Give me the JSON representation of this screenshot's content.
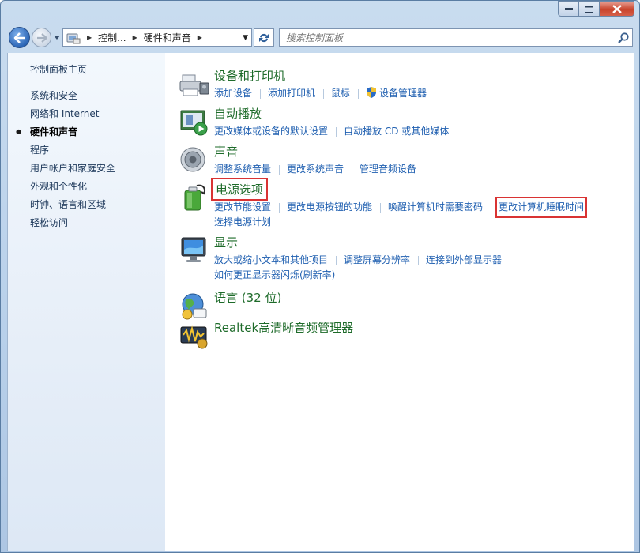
{
  "window": {
    "accent": "#2d67b7"
  },
  "address_bar": {
    "segments": [
      "控制...",
      "硬件和声音"
    ]
  },
  "search": {
    "placeholder": "搜索控制面板"
  },
  "sidebar": {
    "items": [
      {
        "label": "控制面板主页"
      },
      {
        "label": "系统和安全"
      },
      {
        "label": "网络和 Internet"
      },
      {
        "label": "硬件和声音"
      },
      {
        "label": "程序"
      },
      {
        "label": "用户帐户和家庭安全"
      },
      {
        "label": "外观和个性化"
      },
      {
        "label": "时钟、语言和区域"
      },
      {
        "label": "轻松访问"
      }
    ],
    "current": "硬件和声音"
  },
  "categories": [
    {
      "title": "设备和打印机",
      "icon": "printer-icon",
      "links": [
        "添加设备",
        "添加打印机",
        "鼠标",
        "设备管理器"
      ]
    },
    {
      "title": "自动播放",
      "icon": "autoplay-icon",
      "links": [
        "更改媒体或设备的默认设置",
        "自动播放 CD 或其他媒体"
      ]
    },
    {
      "title": "声音",
      "icon": "speaker-icon",
      "links": [
        "调整系统音量",
        "更改系统声音",
        "管理音频设备"
      ]
    },
    {
      "title": "电源选项",
      "icon": "battery-icon",
      "links": [
        "更改节能设置",
        "更改电源按钮的功能",
        "唤醒计算机时需要密码",
        "更改计算机睡眠时间",
        "选择电源计划"
      ]
    },
    {
      "title": "显示",
      "icon": "monitor-icon",
      "links": [
        "放大或缩小文本和其他项目",
        "调整屏幕分辨率",
        "连接到外部显示器",
        "如何更正显示器闪烁(刷新率)"
      ]
    },
    {
      "title": "语言 (32 位)",
      "icon": "language-icon",
      "links": []
    },
    {
      "title": "Realtek高清晰音频管理器",
      "icon": "realtek-audio-icon",
      "links": []
    }
  ]
}
